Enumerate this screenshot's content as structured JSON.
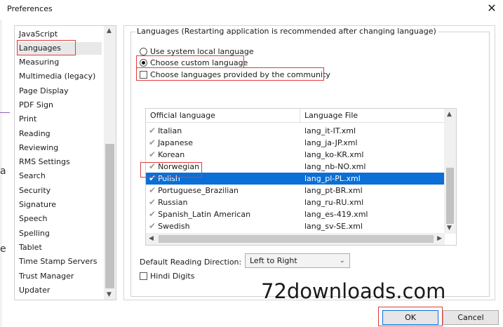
{
  "window": {
    "title": "Preferences",
    "close_glyph": "✕"
  },
  "sidebar": {
    "items": [
      {
        "label": "JavaScript"
      },
      {
        "label": "Languages",
        "selected": true
      },
      {
        "label": "Measuring"
      },
      {
        "label": "Multimedia (legacy)"
      },
      {
        "label": "Page Display"
      },
      {
        "label": "PDF Sign"
      },
      {
        "label": "Print"
      },
      {
        "label": "Reading"
      },
      {
        "label": "Reviewing"
      },
      {
        "label": "RMS Settings"
      },
      {
        "label": "Search"
      },
      {
        "label": "Security"
      },
      {
        "label": "Signature"
      },
      {
        "label": "Speech"
      },
      {
        "label": "Spelling"
      },
      {
        "label": "Tablet"
      },
      {
        "label": "Time Stamp Servers"
      },
      {
        "label": "Trust Manager"
      },
      {
        "label": "Updater"
      }
    ]
  },
  "languages": {
    "legend": "Languages (Restarting application is recommended after changing language)",
    "option_system": "Use system local language",
    "option_custom": "Choose custom language",
    "selected_option": "custom",
    "community_checkbox": "Choose languages provided by the community",
    "community_checked": false
  },
  "table": {
    "headers": [
      "Official language",
      "Language File"
    ],
    "rows": [
      {
        "language": "Italian",
        "file": "lang_it-IT.xml"
      },
      {
        "language": "Japanese",
        "file": "lang_ja-JP.xml"
      },
      {
        "language": "Korean",
        "file": "lang_ko-KR.xml"
      },
      {
        "language": "Norwegian",
        "file": "lang_nb-NO.xml"
      },
      {
        "language": "Polish",
        "file": "lang_pl-PL.xml",
        "selected": true
      },
      {
        "language": "Portuguese_Brazilian",
        "file": "lang_pt-BR.xml"
      },
      {
        "language": "Russian",
        "file": "lang_ru-RU.xml"
      },
      {
        "language": "Spanish_Latin American",
        "file": "lang_es-419.xml"
      },
      {
        "language": "Swedish",
        "file": "lang_sv-SE.xml"
      }
    ]
  },
  "reading": {
    "label": "Default Reading Direction:",
    "value": "Left to Right"
  },
  "hindi": {
    "label": "Hindi Digits",
    "checked": false
  },
  "buttons": {
    "ok": "OK",
    "cancel": "Cancel"
  },
  "watermark": "72downloads.com",
  "edge_glyphs": {
    "a": "a",
    "e": "e"
  },
  "colors": {
    "selection": "#0a6fd6",
    "highlight_box": "#e23b3b",
    "sidebar_selected": "#e8e8e8"
  }
}
